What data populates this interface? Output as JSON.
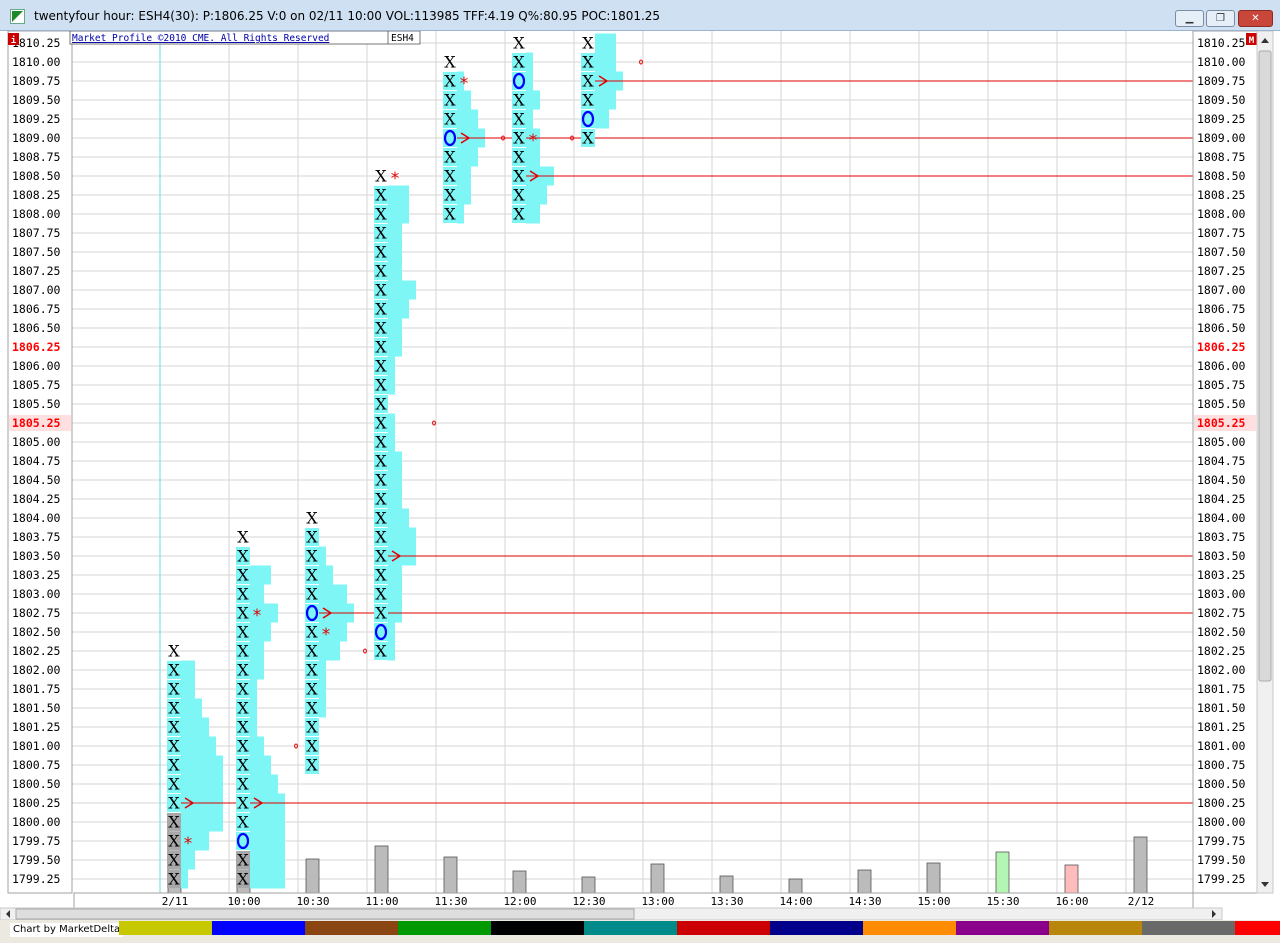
{
  "window": {
    "title": "twentyfour hour: ESH4(30): P:1806.25 V:0 on 02/11 10:00 VOL:113985 TFF:4.19 Q%:80.95 POC:1801.25",
    "min_label": "▁",
    "max_label": "❐",
    "close_label": "✕"
  },
  "header": {
    "copyright": "Market Profile ©2010 CME. All Rights Reserved",
    "symbol": "ESH4",
    "left_badge": "i",
    "right_badge": "M"
  },
  "colors": {
    "profile_bar": "#7ff6f6",
    "letter_fill": "#7ff6f6",
    "letter_text": "#000000",
    "open_mark": "#0000ff",
    "poc_line": "#e00000",
    "highlight_price": "#ff0000",
    "grid": "#d6d6d6",
    "session_line": "#66dddd",
    "volume_gray": "#bbbbbb",
    "volume_green": "#b3f5b3",
    "volume_pink": "#ffbcbc"
  },
  "footer": {
    "credit": "Chart by MarketDelta"
  },
  "swatches": [
    "#c8c800",
    "#0000ff",
    "#8b4513",
    "#009900",
    "#000000",
    "#008b8b",
    "#cc0000",
    "#00008b",
    "#ff8c00",
    "#8b008b",
    "#b8860b",
    "#696969",
    "#ff0000"
  ],
  "chart_data": {
    "type": "market-profile",
    "symbol": "ESH4",
    "tick": 0.25,
    "price_range": [
      1799.25,
      1810.25
    ],
    "price_labels": [
      "1810.25",
      "1810.00",
      "1809.75",
      "1809.50",
      "1809.25",
      "1809.00",
      "1808.75",
      "1808.50",
      "1808.25",
      "1808.00",
      "1807.75",
      "1807.50",
      "1807.25",
      "1807.00",
      "1806.75",
      "1806.50",
      "1806.25",
      "1806.00",
      "1805.75",
      "1805.50",
      "1805.25",
      "1805.00",
      "1804.75",
      "1804.50",
      "1804.25",
      "1804.00",
      "1803.75",
      "1803.50",
      "1803.25",
      "1803.00",
      "1802.75",
      "1802.50",
      "1802.25",
      "1802.00",
      "1801.75",
      "1801.50",
      "1801.25",
      "1801.00",
      "1800.75",
      "1800.50",
      "1800.25",
      "1800.00",
      "1799.75",
      "1799.50",
      "1799.25"
    ],
    "highlighted_prices": [
      "1806.25",
      "1805.25"
    ],
    "time_labels": [
      "2/11",
      "10:00",
      "10:30",
      "11:00",
      "11:30",
      "12:00",
      "12:30",
      "13:00",
      "13:30",
      "14:00",
      "14:30",
      "15:00",
      "15:30",
      "16:00",
      "2/12"
    ],
    "periods": [
      {
        "time": "2/11",
        "high": 1802.25,
        "low": 1799.25,
        "open": null,
        "grey_below": 1800.0,
        "poc": 1800.25,
        "star": 1799.75,
        "dot": null,
        "histogram": [
          [
            1802.25,
            0
          ],
          [
            1802.0,
            2
          ],
          [
            1801.75,
            2
          ],
          [
            1801.5,
            3
          ],
          [
            1801.25,
            4
          ],
          [
            1801.0,
            5
          ],
          [
            1800.75,
            6
          ],
          [
            1800.5,
            6
          ],
          [
            1800.25,
            6
          ],
          [
            1800.0,
            6
          ],
          [
            1799.75,
            4
          ],
          [
            1799.5,
            2
          ],
          [
            1799.25,
            1
          ]
        ],
        "volume": 0
      },
      {
        "time": "10:00",
        "high": 1803.75,
        "low": 1799.25,
        "open": 1799.75,
        "grey_below": 1799.5,
        "poc": 1800.25,
        "star": 1802.75,
        "dot": 1801.0,
        "histogram": [
          [
            1803.75,
            0
          ],
          [
            1803.5,
            0
          ],
          [
            1803.25,
            3
          ],
          [
            1803.0,
            2
          ],
          [
            1802.75,
            4
          ],
          [
            1802.5,
            3
          ],
          [
            1802.25,
            2
          ],
          [
            1802.0,
            2
          ],
          [
            1801.75,
            1
          ],
          [
            1801.5,
            1
          ],
          [
            1801.25,
            1
          ],
          [
            1801.0,
            2
          ],
          [
            1800.75,
            3
          ],
          [
            1800.5,
            4
          ],
          [
            1800.25,
            5
          ],
          [
            1800.0,
            5
          ],
          [
            1799.75,
            5
          ],
          [
            1799.5,
            5
          ],
          [
            1799.25,
            5
          ]
        ],
        "volume": 0
      },
      {
        "time": "10:30",
        "high": 1804.0,
        "low": 1800.75,
        "open": 1802.75,
        "grey_below": null,
        "poc": 1802.75,
        "star": 1802.5,
        "dot": 1802.25,
        "histogram": [
          [
            1804.0,
            0
          ],
          [
            1803.75,
            0
          ],
          [
            1803.5,
            1
          ],
          [
            1803.25,
            2
          ],
          [
            1803.0,
            4
          ],
          [
            1802.75,
            5
          ],
          [
            1802.5,
            4
          ],
          [
            1802.25,
            3
          ],
          [
            1802.0,
            1
          ],
          [
            1801.75,
            1
          ],
          [
            1801.5,
            1
          ],
          [
            1801.25,
            0
          ],
          [
            1801.0,
            0
          ],
          [
            1800.75,
            0
          ]
        ],
        "volume": 0.28
      },
      {
        "time": "11:00",
        "high": 1808.5,
        "low": 1802.25,
        "open": 1802.5,
        "grey_below": null,
        "poc": 1803.5,
        "star": 1808.5,
        "dot": 1805.25,
        "histogram": [
          [
            1808.5,
            0
          ],
          [
            1808.25,
            3
          ],
          [
            1808.0,
            3
          ],
          [
            1807.75,
            2
          ],
          [
            1807.5,
            2
          ],
          [
            1807.25,
            2
          ],
          [
            1807.0,
            4
          ],
          [
            1806.75,
            3
          ],
          [
            1806.5,
            2
          ],
          [
            1806.25,
            2
          ],
          [
            1806.0,
            1
          ],
          [
            1805.75,
            1
          ],
          [
            1805.5,
            0
          ],
          [
            1805.25,
            1
          ],
          [
            1805.0,
            1
          ],
          [
            1804.75,
            2
          ],
          [
            1804.5,
            2
          ],
          [
            1804.25,
            2
          ],
          [
            1804.0,
            3
          ],
          [
            1803.75,
            4
          ],
          [
            1803.5,
            4
          ],
          [
            1803.25,
            2
          ],
          [
            1803.0,
            2
          ],
          [
            1802.75,
            2
          ],
          [
            1802.5,
            1
          ],
          [
            1802.25,
            1
          ]
        ],
        "volume": 0.39
      },
      {
        "time": "11:30",
        "high": 1810.0,
        "low": 1808.0,
        "open": 1809.0,
        "grey_below": null,
        "poc": 1809.0,
        "star": 1809.75,
        "dot": 1809.0,
        "histogram": [
          [
            1810.0,
            0
          ],
          [
            1809.75,
            1
          ],
          [
            1809.5,
            2
          ],
          [
            1809.25,
            3
          ],
          [
            1809.0,
            4
          ],
          [
            1808.75,
            3
          ],
          [
            1808.5,
            2
          ],
          [
            1808.25,
            2
          ],
          [
            1808.0,
            1
          ]
        ],
        "volume": 0.3
      },
      {
        "time": "12:00",
        "high": 1810.25,
        "low": 1808.0,
        "open": 1809.75,
        "grey_below": null,
        "poc": 1808.5,
        "star": 1809.0,
        "dot": 1809.0,
        "histogram": [
          [
            1810.25,
            0
          ],
          [
            1810.0,
            1
          ],
          [
            1809.75,
            1
          ],
          [
            1809.5,
            2
          ],
          [
            1809.25,
            1
          ],
          [
            1809.0,
            2
          ],
          [
            1808.75,
            2
          ],
          [
            1808.5,
            4
          ],
          [
            1808.25,
            3
          ],
          [
            1808.0,
            2
          ]
        ],
        "volume": 0.18
      },
      {
        "time": "12:30",
        "high": 1810.25,
        "low": 1809.0,
        "open": 1809.25,
        "grey_below": null,
        "poc": 1809.75,
        "star": null,
        "dot": 1810.0,
        "histogram": [
          [
            1810.25,
            3
          ],
          [
            1810.0,
            3
          ],
          [
            1809.75,
            4
          ],
          [
            1809.5,
            3
          ],
          [
            1809.25,
            2
          ],
          [
            1809.0,
            0
          ]
        ],
        "volume": 0.13
      }
    ],
    "volume_bars": [
      {
        "time": "2/11",
        "value": 0.62,
        "color": "gray"
      },
      {
        "time": "10:00",
        "value": 0.28,
        "color": "gray"
      },
      {
        "time": "10:30",
        "value": 0.28,
        "color": "gray"
      },
      {
        "time": "11:00",
        "value": 0.39,
        "color": "gray"
      },
      {
        "time": "11:30",
        "value": 0.3,
        "color": "gray"
      },
      {
        "time": "12:00",
        "value": 0.18,
        "color": "gray"
      },
      {
        "time": "12:30",
        "value": 0.13,
        "color": "gray"
      },
      {
        "time": "13:00",
        "value": 0.24,
        "color": "gray"
      },
      {
        "time": "13:30",
        "value": 0.14,
        "color": "gray"
      },
      {
        "time": "14:00",
        "value": 0.12,
        "color": "gray"
      },
      {
        "time": "14:30",
        "value": 0.19,
        "color": "gray"
      },
      {
        "time": "15:00",
        "value": 0.25,
        "color": "gray"
      },
      {
        "time": "15:30",
        "value": 0.34,
        "color": "green"
      },
      {
        "time": "16:00",
        "value": 0.23,
        "color": "pink"
      },
      {
        "time": "2/12",
        "value": 0.47,
        "color": "gray"
      }
    ],
    "grid": true
  }
}
